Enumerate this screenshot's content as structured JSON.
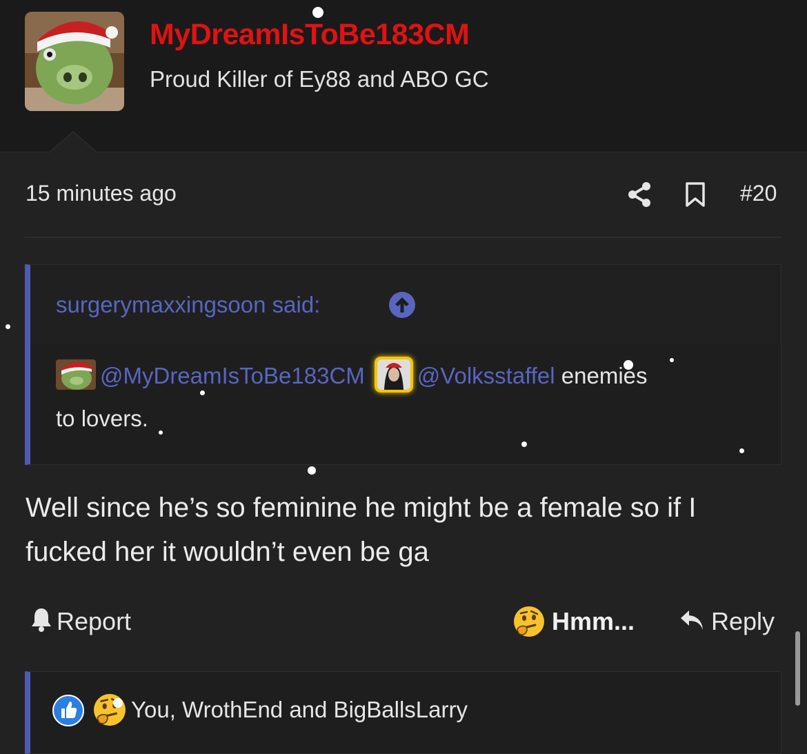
{
  "author": {
    "username": "MyDreamIsToBe183CM",
    "user_title": "Proud Killer of Ey88 and ABO GC",
    "avatar": "green-pig-with-santa-hat-avatar"
  },
  "post_meta": {
    "timestamp": "15 minutes ago",
    "post_number": "#20",
    "icons": [
      "share-icon",
      "bookmark-icon"
    ]
  },
  "quote": {
    "attribution": "surgerymaxxingsoon said:",
    "mention_1": "@MyDreamIsToBe183CM",
    "mention_2": "@Volksstaffel",
    "text_part_1": " enemies",
    "text_part_2": "to lovers."
  },
  "message": {
    "text": "Well since he’s so feminine he might be a female so if I fucked her it wouldn’t even be ga"
  },
  "actions": {
    "report_label": "Report",
    "reaction_label": "Hmm...",
    "reply_label": "Reply"
  },
  "reactions_summary": {
    "icons": [
      "like-icon",
      "thinking-face-icon"
    ],
    "text": "You, WrothEnd and BigBallsLarry"
  },
  "colors": {
    "username": "#e01212",
    "accent": "#5866c0",
    "background": "#222223",
    "highlight": "#f7c500"
  }
}
